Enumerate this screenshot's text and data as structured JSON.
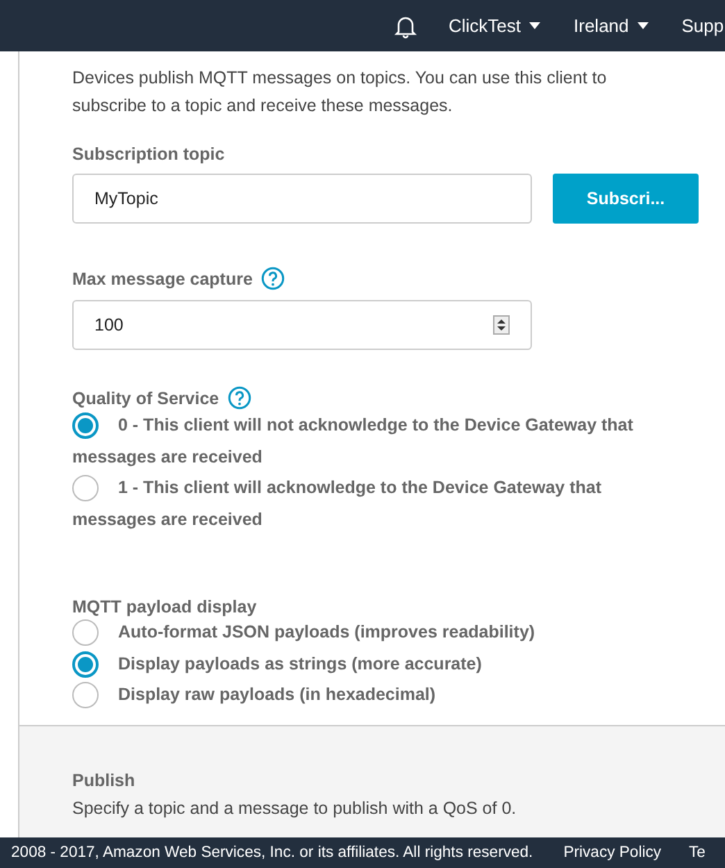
{
  "top_bar": {
    "account": "ClickTest",
    "region": "Ireland",
    "support": "Supp"
  },
  "intro": "Devices publish MQTT messages on topics. You can use this client to subscribe to a topic and receive these messages.",
  "subscription_topic": {
    "label": "Subscription topic",
    "value": "MyTopic",
    "button": "Subscri..."
  },
  "max_message_capture": {
    "label": "Max message capture",
    "value": "100"
  },
  "quality_of_service": {
    "label": "Quality of Service",
    "options": [
      {
        "label": "0 - This client will not acknowledge to the Device Gateway that",
        "label_continued": "messages are received",
        "selected": true
      },
      {
        "label": "1 - This client will acknowledge to the Device Gateway that",
        "label_continued": "messages are received",
        "selected": false
      }
    ]
  },
  "payload_display": {
    "label": "MQTT payload display",
    "options": [
      {
        "label": "Auto-format JSON payloads (improves readability)",
        "selected": false
      },
      {
        "label": "Display payloads as strings (more accurate)",
        "selected": true
      },
      {
        "label": "Display raw payloads (in hexadecimal)",
        "selected": false
      }
    ]
  },
  "publish": {
    "title": "Publish",
    "description": "Specify a topic and a message to publish with a QoS of 0."
  },
  "footer": {
    "copyright": "2008 - 2017, Amazon Web Services, Inc. or its affiliates. All rights reserved.",
    "privacy": "Privacy Policy",
    "terms": "Te"
  }
}
